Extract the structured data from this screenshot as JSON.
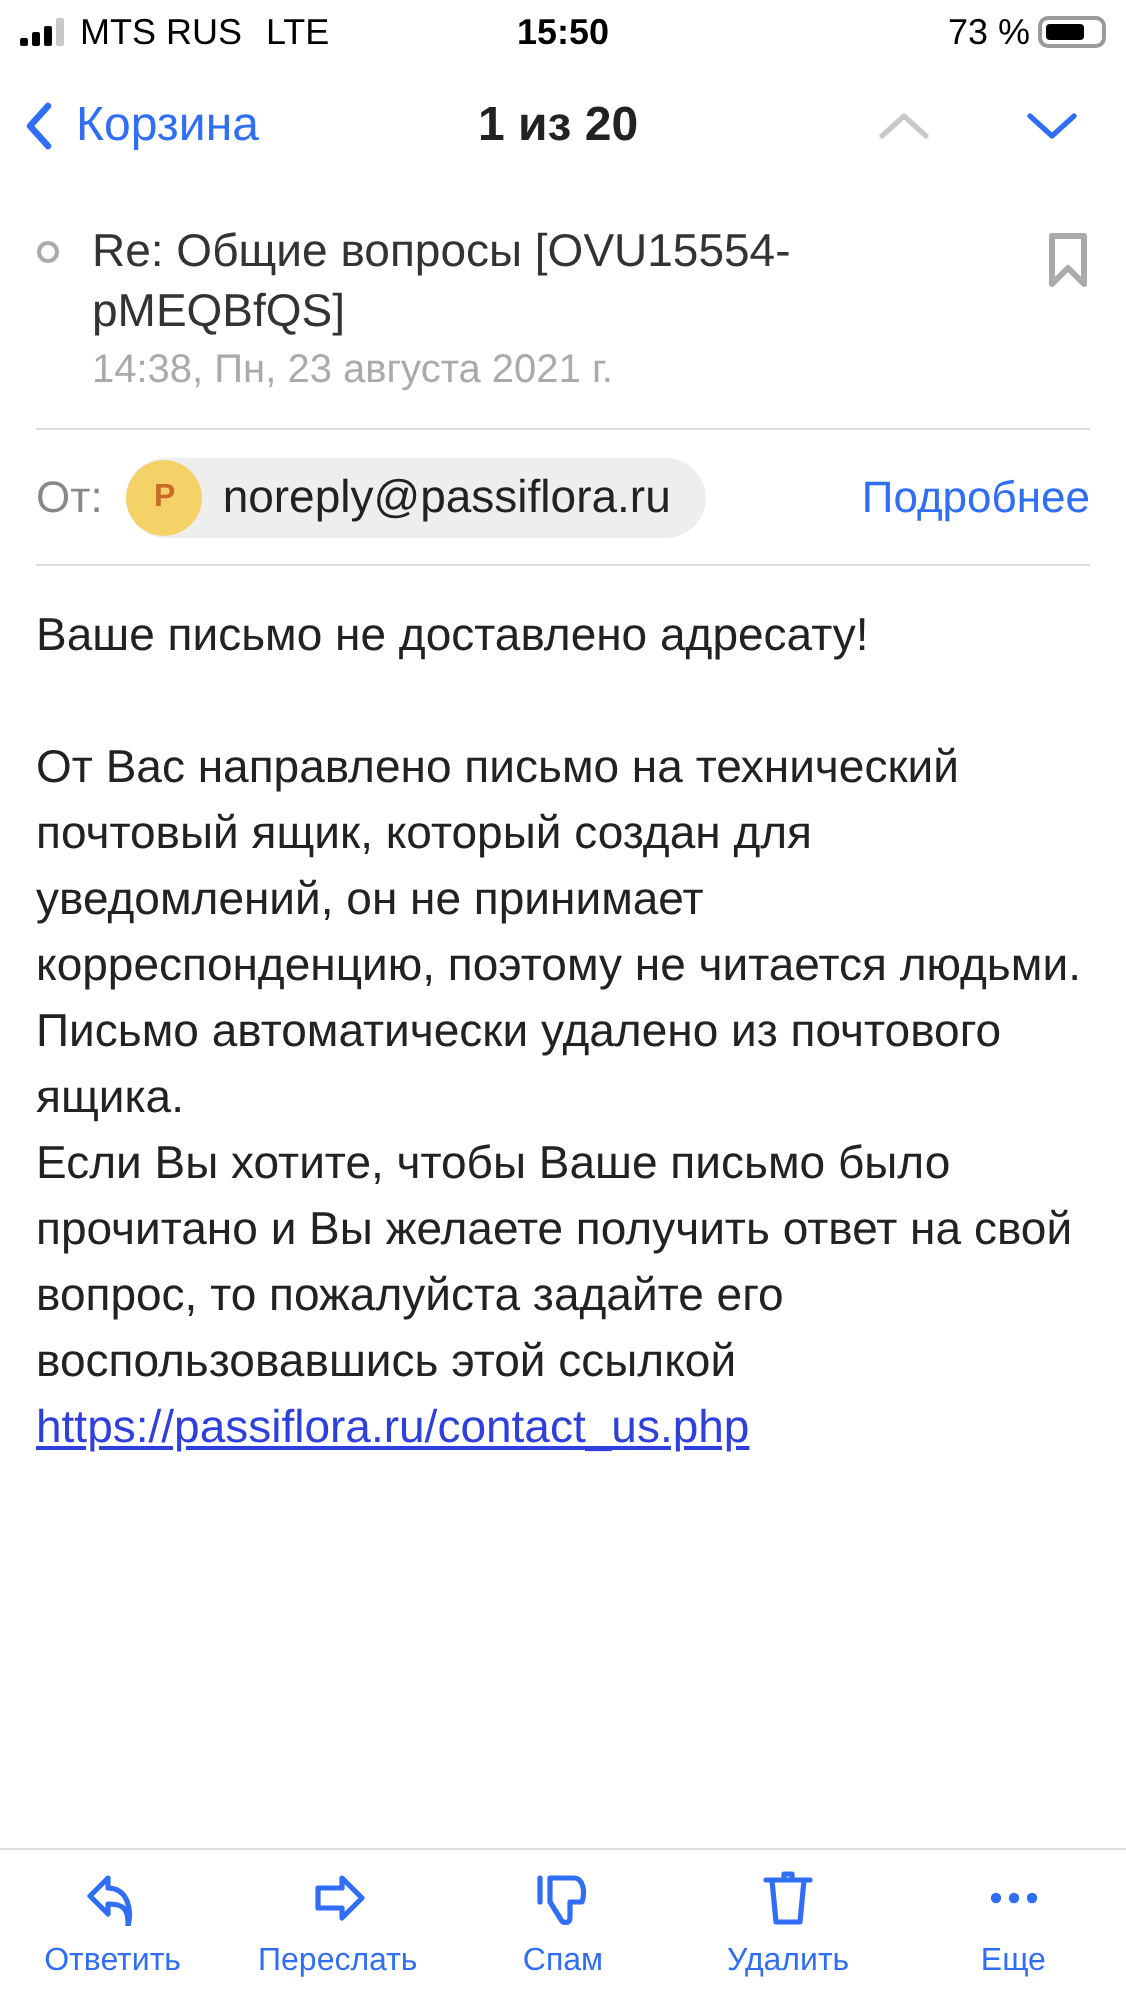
{
  "status_bar": {
    "carrier": "MTS RUS",
    "network": "LTE",
    "time": "15:50",
    "battery_text": "73 %"
  },
  "nav": {
    "back_label": "Корзина",
    "counter": "1 из 20",
    "prev_disabled": true,
    "next_disabled": false
  },
  "message": {
    "subject": "Re: Общие вопросы [OVU15554-pMEQBfQS]",
    "date": "14:38, Пн, 23 августа 2021 г.",
    "from_label": "От:",
    "avatar_letter": "P",
    "sender": "noreply@passiflora.ru",
    "details": "Подробнее"
  },
  "body": [
    {
      "kind": "text",
      "text": "Ваше письмо не доставлено адресату!"
    },
    {
      "kind": "gap"
    },
    {
      "kind": "text",
      "text": "От Вас направлено письмо на технический почтовый ящик, который создан для уведомлений, он не принимает корреспонденцию, поэтому не читается людьми. Письмо автоматически удалено из почтового ящика."
    },
    {
      "kind": "text",
      "text": "Если Вы хотите, чтобы Ваше письмо было прочитано и Вы желаете получить ответ на свой вопрос, то пожалуйста задайте его воспользовавшись этой ссылкой"
    },
    {
      "kind": "link",
      "text": "https://passiflora.ru/contact_us.php"
    }
  ],
  "toolbar": [
    {
      "kind": "reply",
      "label": "Ответить"
    },
    {
      "kind": "forward",
      "label": "Переслать"
    },
    {
      "kind": "spam",
      "label": "Спам"
    },
    {
      "kind": "delete",
      "label": "Удалить"
    },
    {
      "kind": "more",
      "label": "Еще"
    }
  ]
}
